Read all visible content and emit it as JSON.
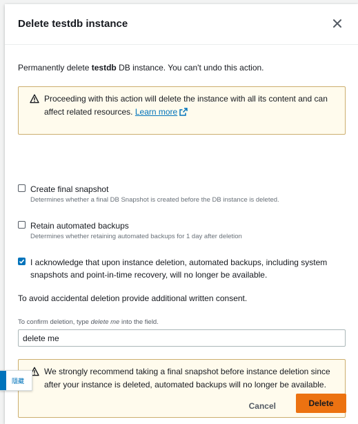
{
  "modal": {
    "title": "Delete testdb instance"
  },
  "intro": {
    "prefix": "Permanently delete ",
    "instance_name": "testdb",
    "suffix": " DB instance. You can't undo this action."
  },
  "alert_top": {
    "text": "Proceeding with this action will delete the instance with all its content and can affect related resources. ",
    "link_label": "Learn more",
    "icon": "warning-icon"
  },
  "options": [
    {
      "label": "Create final snapshot",
      "description": "Determines whether a final DB Snapshot is created before the DB instance is deleted.",
      "checked": false
    },
    {
      "label": "Retain automated backups",
      "description": "Determines whether retaining automated backups for 1 day after deletion",
      "checked": false
    },
    {
      "label": "I acknowledge that upon instance deletion, automated backups, including system snapshots and point-in-time recovery, will no longer be available.",
      "description": "",
      "checked": true
    }
  ],
  "consent": {
    "text": "To avoid accidental deletion provide additional written consent.",
    "label_prefix": "To confirm deletion, type ",
    "label_emphasis": "delete me",
    "label_suffix": " into the field.",
    "input_value": "delete me"
  },
  "alert_bottom": {
    "text": "We strongly recommend taking a final snapshot before instance deletion since after your instance is deleted, automated backups will no longer be available.",
    "icon": "warning-icon"
  },
  "footer": {
    "cancel_label": "Cancel",
    "delete_label": "Delete"
  },
  "side_widget": {
    "label": "隱藏"
  },
  "colors": {
    "primary_button": "#ec7211",
    "link": "#0073bb",
    "alert_background": "#fffbed",
    "alert_border": "#ccae6e",
    "checkbox_checked": "#0073bb"
  }
}
